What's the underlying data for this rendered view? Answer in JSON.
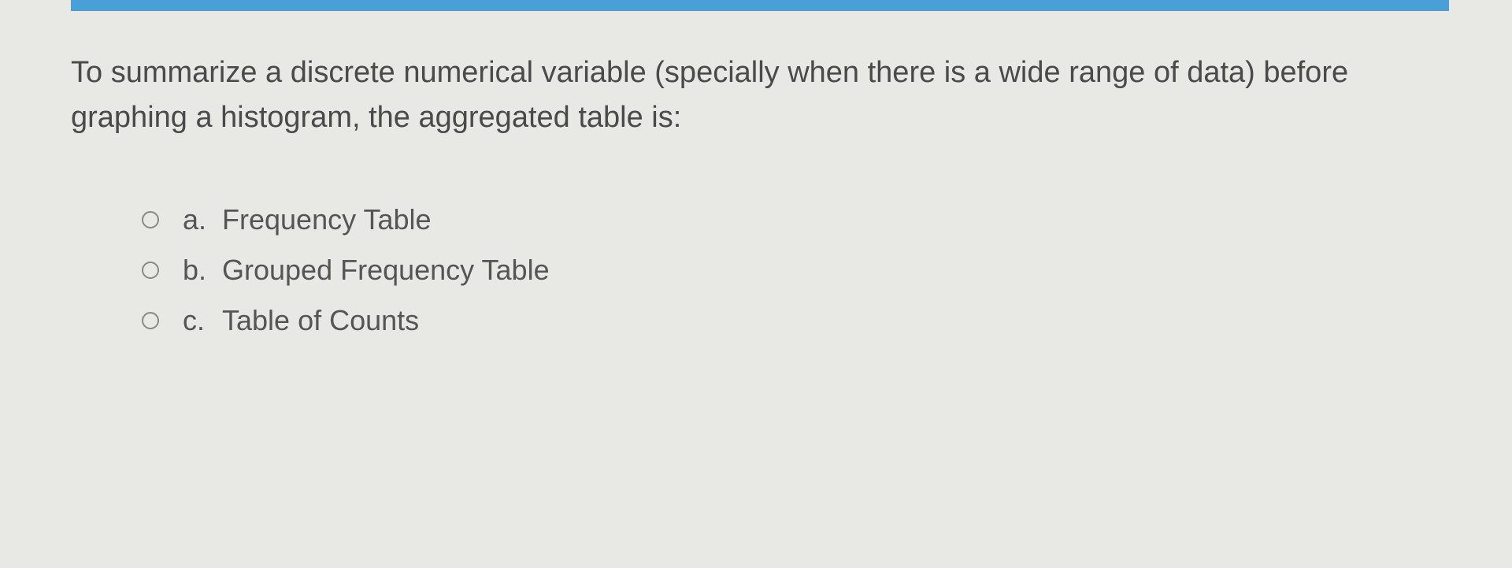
{
  "question": {
    "text": "To summarize a discrete numerical variable (specially when there is a wide range of data) before graphing a histogram, the aggregated table is:"
  },
  "options": [
    {
      "letter": "a.",
      "text": "Frequency Table"
    },
    {
      "letter": "b.",
      "text": "Grouped Frequency Table"
    },
    {
      "letter": "c.",
      "text": "Table of Counts"
    }
  ]
}
